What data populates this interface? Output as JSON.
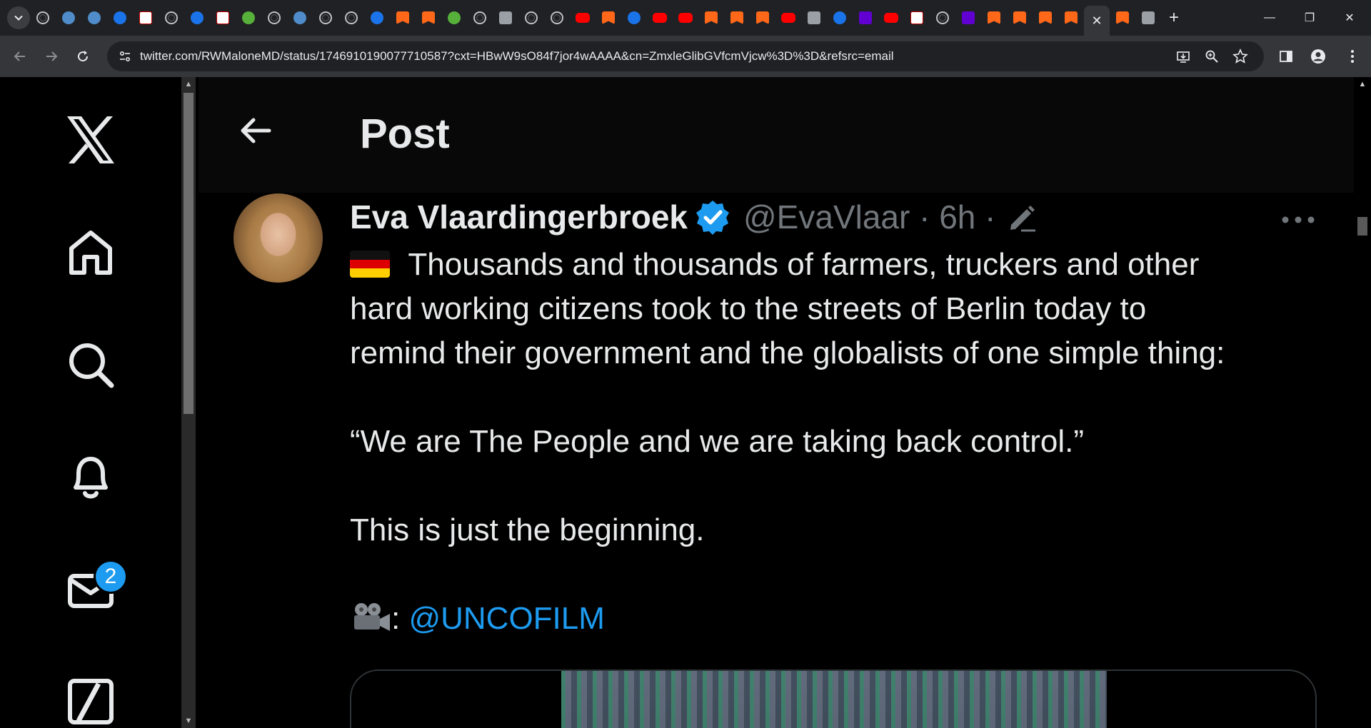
{
  "browser": {
    "active_tab_close": "✕",
    "new_tab": "+",
    "url": "twitter.com/RWMaloneMD/status/1746910190077710587?cxt=HBwW9sO84f7jor4wAAAA&cn=ZmxleGlibGVfcmVjcw%3D%3D&refsrc=email",
    "window_controls": {
      "minimize": "—",
      "maximize": "❐",
      "close": "✕"
    }
  },
  "nav": {
    "messages_badge": "2"
  },
  "header": {
    "title": "Post"
  },
  "tweet": {
    "author_name": "Eva Vlaardingerbroek",
    "handle_time": "@EvaVlaar · 6h ·",
    "line1": " Thousands and thousands of farmers, truckers and other",
    "line2": "hard working citizens took to the streets of Berlin today to",
    "line3": "remind their government and the globalists of one simple thing:",
    "line4": "“We are The People and we are taking back control.”",
    "line5": "This is just the beginning.",
    "credit_sep": ": ",
    "credit_mention": "@UNCOFILM"
  },
  "colors": {
    "accent": "#1d9bf0",
    "background": "#000000",
    "text": "#e7e9ea",
    "muted": "#71767b"
  }
}
